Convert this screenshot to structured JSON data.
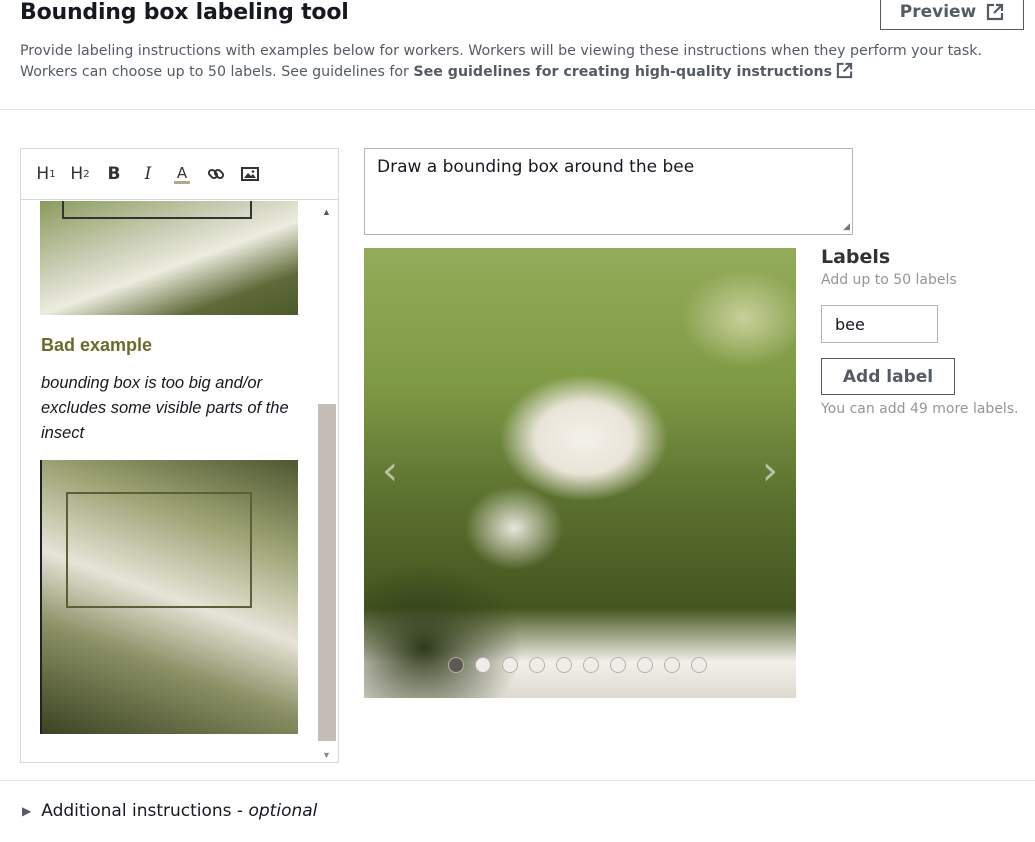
{
  "header": {
    "title": "Bounding box labeling tool",
    "preview_label": "Preview",
    "description": "Provide labeling instructions with examples below for workers. Workers will be viewing these instructions when they perform your task. Workers can choose up to 50 labels. See guidelines for ",
    "guidelines_link": "See guidelines for creating high-quality instructions"
  },
  "toolbar": {
    "h1": "H",
    "h1_sub": "1",
    "h2": "H",
    "h2_sub": "2",
    "bold": "B",
    "italic": "I",
    "font_color": "A"
  },
  "editor": {
    "bad_example_title": "Bad example",
    "bad_example_text": "bounding box is too big and/or excludes some visible parts of the insect"
  },
  "instruction": {
    "value": "Draw a bounding box around the bee"
  },
  "carousel": {
    "slide_count": 10,
    "active_index": 0
  },
  "labels": {
    "title": "Labels",
    "subtitle": "Add up to 50 labels",
    "items": [
      "bee"
    ],
    "add_button": "Add label",
    "remaining_note": "You can add 49 more labels."
  },
  "footer": {
    "additional_label": "Additional instructions - ",
    "optional_label": "optional"
  },
  "colors": {
    "accent_text": "#545b64",
    "bad_example_title": "#6b6b2d",
    "muted_text": "#959595"
  }
}
